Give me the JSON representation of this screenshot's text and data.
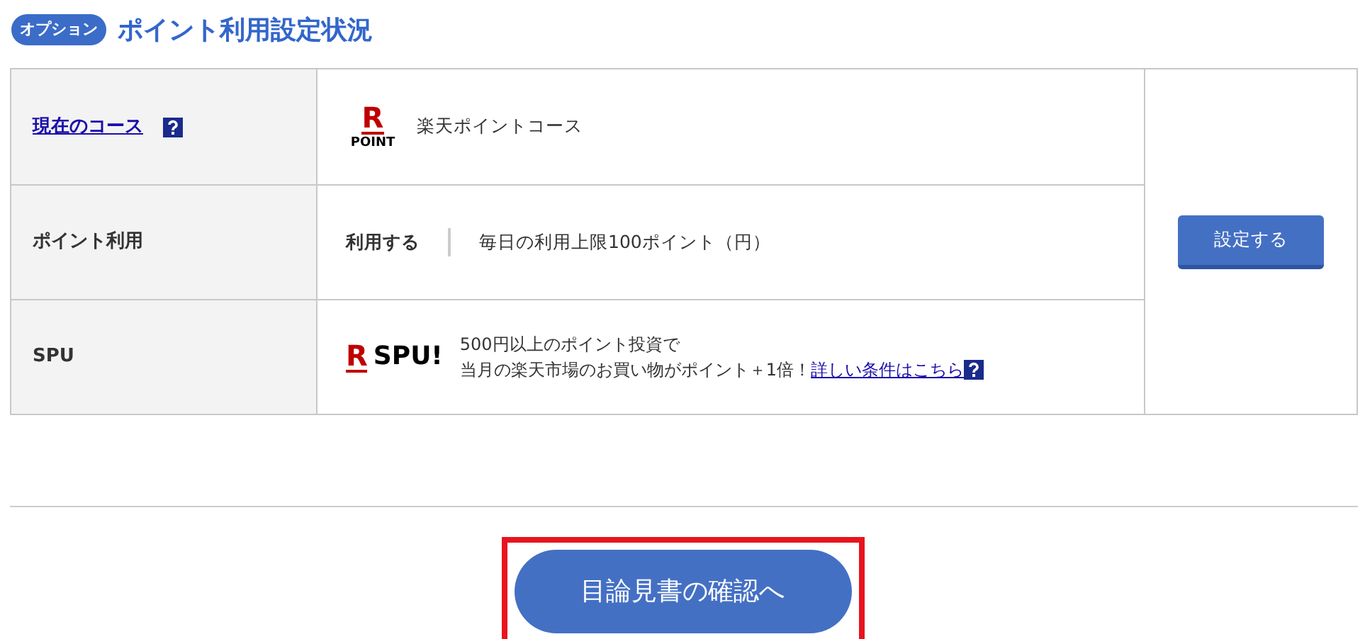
{
  "header": {
    "badge": "オプション",
    "title": "ポイント利用設定状況"
  },
  "rows": [
    {
      "kind": "course",
      "label": "現在のコース",
      "label_link": true,
      "help": true,
      "logo_mark": "R",
      "logo_caption": "POINT",
      "value": "楽天ポイントコース"
    },
    {
      "kind": "usage",
      "label": "ポイント利用",
      "label_link": false,
      "help": false,
      "value": "利用する",
      "detail": "毎日の利用上限100ポイント（円）"
    },
    {
      "kind": "spu",
      "label": "SPU",
      "label_link": false,
      "help": false,
      "logo_mark": "R",
      "logo_caption": "SPU!",
      "line_1": "500円以上のポイント投資で",
      "line_2": "当月の楽天市場のお買い物がポイント＋1倍！",
      "link": "詳しい条件はこちら"
    }
  ],
  "settings_button": "設定する",
  "confirm_button": {
    "label": "目論見書の確認へ",
    "highlighted": true
  }
}
